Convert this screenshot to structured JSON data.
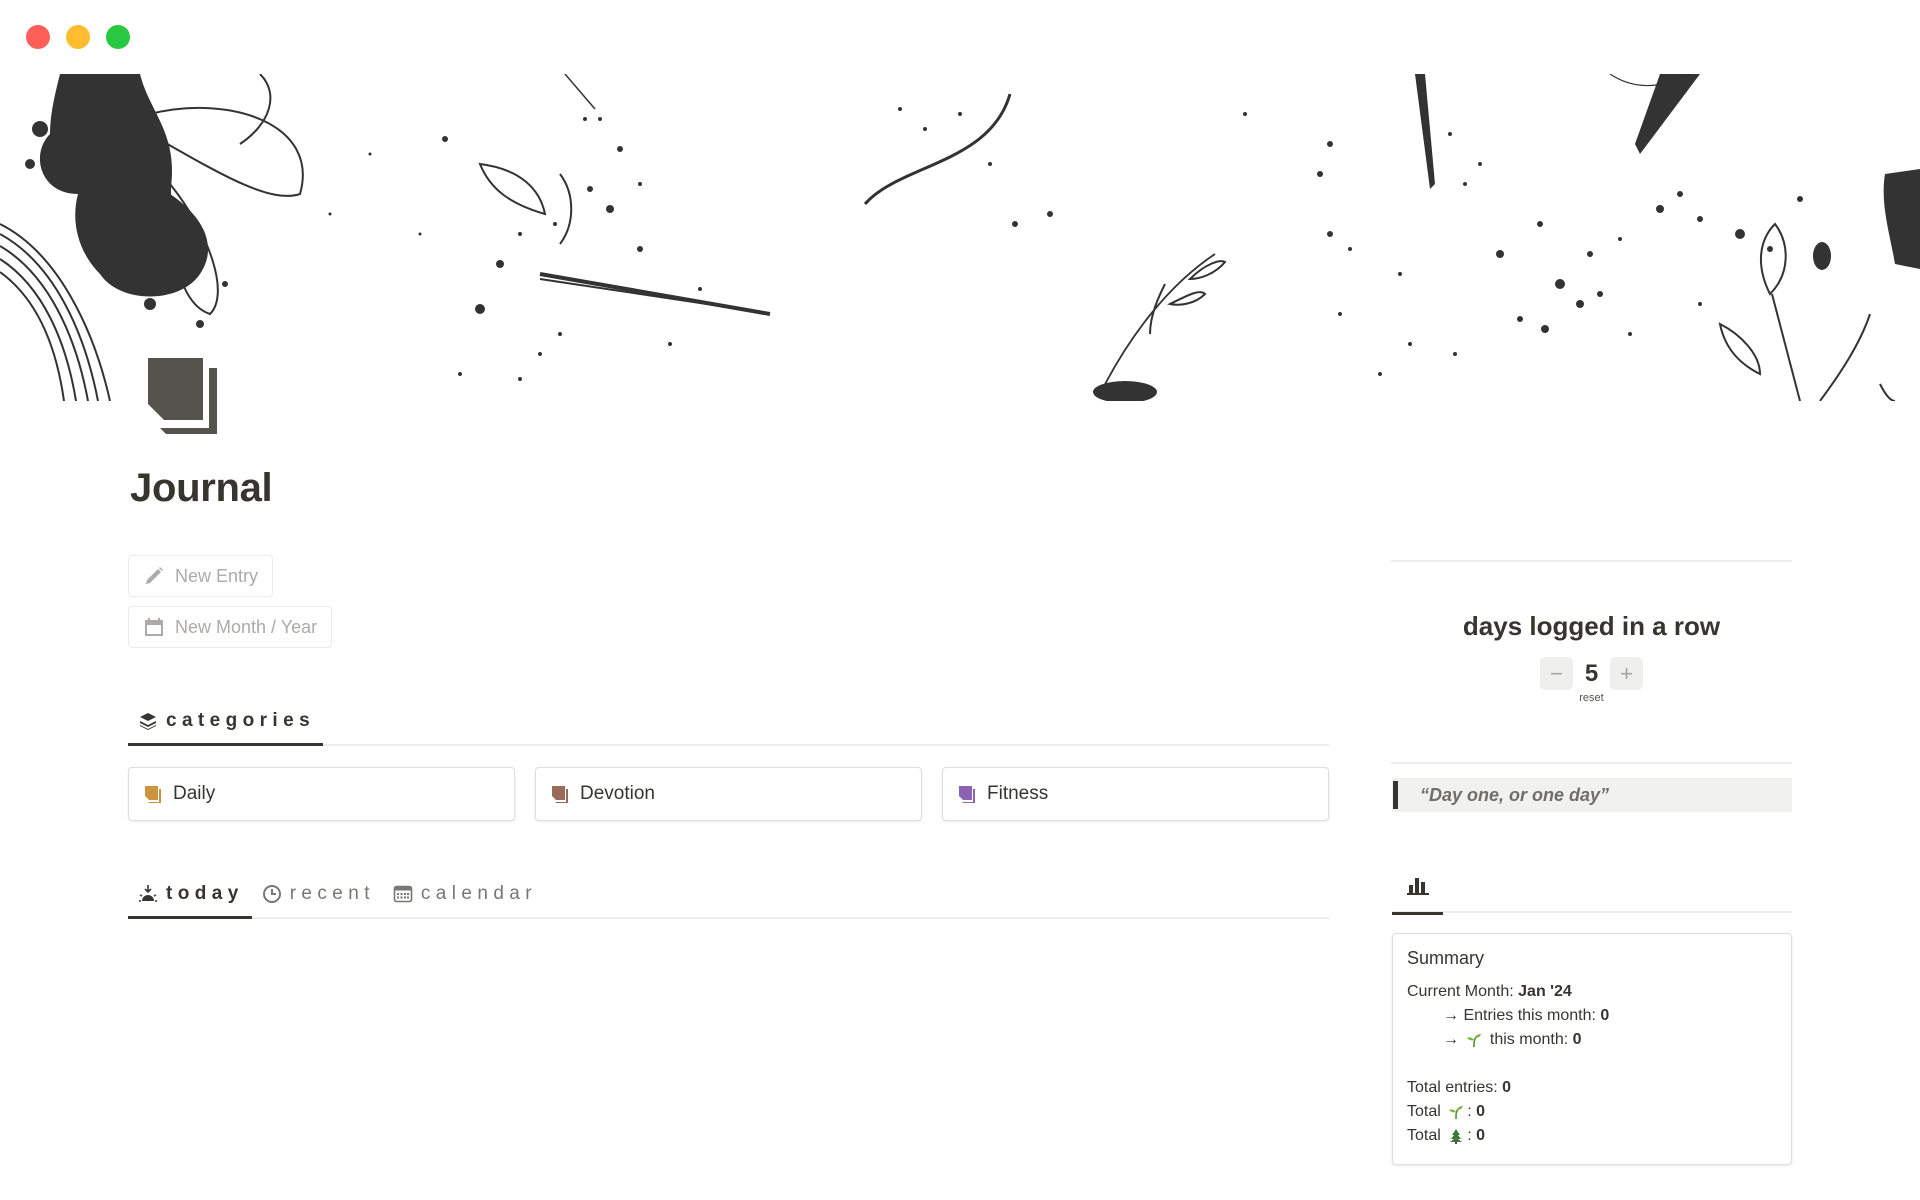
{
  "window": {
    "controls": [
      {
        "name": "close",
        "color": "#ff5f57"
      },
      {
        "name": "minimize",
        "color": "#febc2e"
      },
      {
        "name": "maximize",
        "color": "#28c840"
      }
    ]
  },
  "page": {
    "title": "Journal",
    "icon": "notes-pages-icon"
  },
  "actions": {
    "new_entry": "New Entry",
    "new_month_year": "New Month / Year"
  },
  "categories_tab": {
    "label": "categories",
    "icon": "layers-icon"
  },
  "categories": [
    {
      "label": "Daily",
      "icon_color": "#c9963f"
    },
    {
      "label": "Devotion",
      "icon_color": "#9a6a58"
    },
    {
      "label": "Fitness",
      "icon_color": "#8e62b3"
    }
  ],
  "view_tabs": [
    {
      "label": "today",
      "icon": "sunrise-icon",
      "active": true
    },
    {
      "label": "recent",
      "icon": "clock-icon",
      "active": false
    },
    {
      "label": "calendar",
      "icon": "calendar-icon",
      "active": false
    }
  ],
  "streak": {
    "title": "days logged in a row",
    "value": "5",
    "decrement": "−",
    "increment": "+",
    "reset": "reset"
  },
  "quote": "“Day one, or one day”",
  "stats_tab": {
    "icon": "bar-chart-icon"
  },
  "summary": {
    "title": "Summary",
    "current_month_label": "Current Month: ",
    "current_month_value": "Jan '24",
    "entries_month_label": "→ Entries this month: ",
    "entries_month_value": "0",
    "sprout_month_prefix": "→ ",
    "sprout_month_label": " this month: ",
    "sprout_month_value": "0",
    "total_entries_label": "Total entries: ",
    "total_entries_value": "0",
    "total_sprout_label": "Total ",
    "total_sprout_value": "0",
    "total_tree_label": "Total ",
    "total_tree_value": "0",
    "sep": ": "
  }
}
